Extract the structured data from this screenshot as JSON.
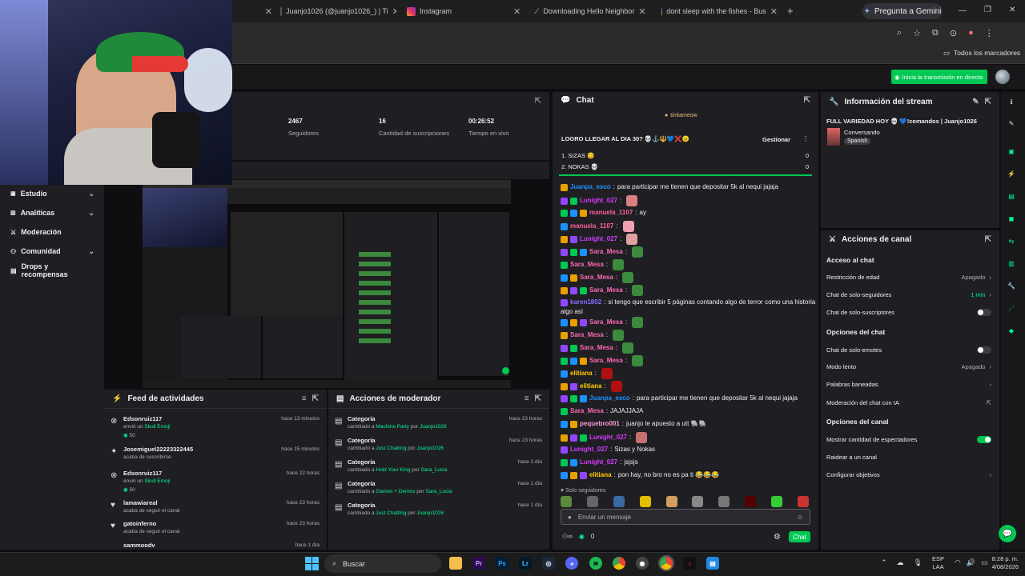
{
  "browser": {
    "tabs": [
      {
        "label": "Juanjo1026 (@juanjo1026_) | Ti"
      },
      {
        "label": "Instagram"
      },
      {
        "label": "Downloading Hello Neighbor"
      },
      {
        "label": "dont sleep with the fishes - Bus"
      }
    ],
    "gemini_label": "Pregunta a Gemini",
    "bookmarks_label": "Todos los marcadores"
  },
  "topbar": {
    "go_live": "Inicia la transmisión en directo"
  },
  "nav": {
    "items": [
      {
        "label": "Estudio"
      },
      {
        "label": "Analíticas"
      },
      {
        "label": "Moderación"
      },
      {
        "label": "Comunidad"
      },
      {
        "label": "Drops y recompensas"
      }
    ]
  },
  "stats": {
    "followers": "2467",
    "followers_label": "Seguidores",
    "subs": "16",
    "subs_label": "Cantidad de suscripciones",
    "live": "00:26:52",
    "live_label": "Tiempo en vivo"
  },
  "feed": {
    "title": "Feed de actividades",
    "items": [
      {
        "name": "Edsonruiz117",
        "sub": "envió un",
        "reward": "Skull Emoji",
        "points": "50",
        "time": "hace 13 minutos"
      },
      {
        "name": "Josemiguel22223322445",
        "sub": "acaba de suscribirse",
        "time": "hace 15 minutos"
      },
      {
        "name": "Edsonruiz117",
        "sub": "envió un",
        "reward": "Skull Emoji",
        "points": "50",
        "time": "hace 22 horas"
      },
      {
        "name": "lamawiareal",
        "sub": "acaba de seguir el canal",
        "time": "hace 23 horas"
      },
      {
        "name": "gatoinferno",
        "sub": "acaba de seguir el canal",
        "time": "hace 23 horas"
      },
      {
        "name": "sammoodv",
        "time": "hace 1 día"
      }
    ]
  },
  "modactions": {
    "title": "Acciones de moderador",
    "items": [
      {
        "title": "Categoría",
        "prefix": "cambiado a",
        "game": "Machine Party",
        "by": "por",
        "user": "Juanjo1026",
        "time": "hace 23 horas"
      },
      {
        "title": "Categoría",
        "prefix": "cambiado a",
        "game": "Just Chatting",
        "by": "por",
        "user": "Juanjo1026",
        "time": "hace 23 horas"
      },
      {
        "title": "Categoría",
        "prefix": "cambiado a",
        "game": "Hold Your King",
        "by": "por",
        "user": "Sara_Lucia",
        "time": "hace 1 día"
      },
      {
        "title": "Categoría",
        "prefix": "cambiado a",
        "game": "Games + Demos",
        "by": "por",
        "user": "Sara_Lucia",
        "time": "hace 1 día"
      },
      {
        "title": "Categoría",
        "prefix": "cambiado a",
        "game": "Just Chatting",
        "by": "por",
        "user": "Juanjo1026",
        "time": "hace 1 día"
      }
    ]
  },
  "chat": {
    "title": "Chat",
    "pinned_user": "tinitameow",
    "poll_title": "LOGRO LLEGAR AL DIA 30? 💀⚓🔱💙❌😐",
    "manage": "Gestionar",
    "poll_options": [
      {
        "label": "1. SIZAS 😊",
        "count": "0"
      },
      {
        "label": "2. NOKAS 💀",
        "count": "0"
      }
    ],
    "messages": [
      {
        "user": "Juanpa_esco",
        "color": "#1e90ff",
        "text": "para participar me tienen que depositar 5k al nequi jajaja"
      },
      {
        "user": "Lunight_027",
        "color": "#d63bff",
        "text": "",
        "emote": "#d88080"
      },
      {
        "user": "manuela_1107",
        "color": "#ff5fa2",
        "text": "ay"
      },
      {
        "user": "manuela_1107",
        "color": "#ff5fa2",
        "text": "",
        "emote": "#f0a0b0"
      },
      {
        "user": "Lunight_027",
        "color": "#d63bff",
        "text": "",
        "emote": "#e0a0a0"
      },
      {
        "user": "Sara_Mesa",
        "color": "#ff69b4",
        "text": "",
        "emote": "#3c8a3c"
      },
      {
        "user": "Sara_Mesa",
        "color": "#ff69b4",
        "text": "",
        "emote": "#3c8a3c"
      },
      {
        "user": "Sara_Mesa",
        "color": "#ff69b4",
        "text": "",
        "emote": "#3c8a3c"
      },
      {
        "user": "Sara_Mesa",
        "color": "#ff69b4",
        "text": "",
        "emote": "#3c8a3c"
      },
      {
        "user": "karen1802",
        "color": "#8a6cff",
        "text": "si tengo que escribir 5 páginas contando algo de terror como una historia"
      },
      {
        "user": "",
        "color": "#efeff1",
        "text": "algo así"
      },
      {
        "user": "Sara_Mesa",
        "color": "#ff69b4",
        "text": "",
        "emote": "#3c8a3c"
      },
      {
        "user": "Sara_Mesa",
        "color": "#ff69b4",
        "text": "",
        "emote": "#3c8a3c"
      },
      {
        "user": "Sara_Mesa",
        "color": "#ff69b4",
        "text": "",
        "emote": "#3c8a3c"
      },
      {
        "user": "Sara_Mesa",
        "color": "#ff69b4",
        "text": "",
        "emote": "#3c8a3c"
      },
      {
        "user": "elitiana",
        "color": "#ffcc00",
        "text": "",
        "emote": "#b01010"
      },
      {
        "user": "elitiana",
        "color": "#ffcc00",
        "text": "",
        "emote": "#b01010"
      },
      {
        "user": "Juanpa_esco",
        "color": "#1e90ff",
        "text": "para participar me tienen que depositar 5k al nequi jajaja"
      },
      {
        "user": "Sara_Mesa",
        "color": "#ff69b4",
        "text": "JAJAJJAJA"
      },
      {
        "user": "pequebro001",
        "color": "#ff9ad5",
        "text": "juanjo le apuesto a utt 🐘🐘"
      },
      {
        "user": "Lunight_027",
        "color": "#d63bff",
        "text": "",
        "emote": "#c87070"
      },
      {
        "user": "Lunight_027",
        "color": "#d63bff",
        "text": "Sizas y Nokas"
      },
      {
        "user": "Lunight_027",
        "color": "#d63bff",
        "text": "jsjsjs"
      },
      {
        "user": "elitiana",
        "color": "#ffcc00",
        "text": "pon hay, no bro no es pa ti 😂😂😂"
      }
    ],
    "followers_only": "Solo seguidores",
    "input_placeholder": "Enviar un mensaje",
    "points": "0",
    "send": "Chat"
  },
  "info": {
    "title": "Información del stream",
    "stream_title": "FULL VARIEDAD HOY 💀 💙!comandos | Juanjo1026",
    "category": "Conversando",
    "tag": "Spanish"
  },
  "actions": {
    "title": "Acciones de canal",
    "sections": [
      {
        "header": "Acceso al chat"
      },
      {
        "header": "Opciones del chat"
      },
      {
        "header": "Opciones del canal"
      }
    ],
    "rows": [
      {
        "label": "Restricción de edad",
        "value": "Apagado"
      },
      {
        "label": "Chat de solo-seguidores",
        "value": "1 min"
      },
      {
        "label": "Chat de solo-suscriptores",
        "value": ""
      },
      {
        "label": "Chat de solo-emotes",
        "value": ""
      },
      {
        "label": "Modo lento",
        "value": "Apagado"
      },
      {
        "label": "Palabras baneadas",
        "value": ""
      },
      {
        "label": "Moderación del chat con IA",
        "value": ""
      },
      {
        "label": "Mostrar cantidad de espectadores",
        "value": ""
      },
      {
        "label": "Raidear a un canal",
        "value": ""
      },
      {
        "label": "Configurar objetivos",
        "value": ""
      }
    ]
  },
  "taskbar": {
    "search": "Buscar",
    "lang": "ESP",
    "lang2": "LAA",
    "time": "8:28 p. m.",
    "date": "4/08/2026"
  }
}
